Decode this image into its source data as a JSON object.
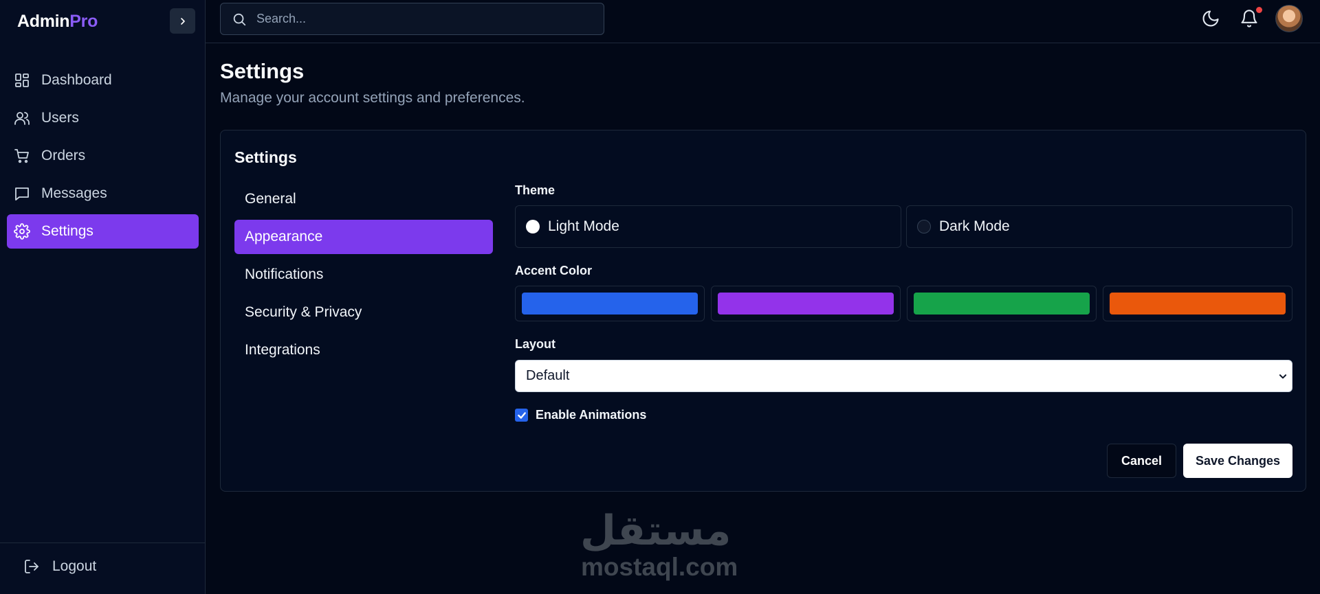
{
  "brand": {
    "part1": "Admin",
    "part2": "Pro"
  },
  "sidebar": {
    "items": [
      {
        "label": "Dashboard",
        "icon": "dashboard-icon"
      },
      {
        "label": "Users",
        "icon": "users-icon"
      },
      {
        "label": "Orders",
        "icon": "cart-icon"
      },
      {
        "label": "Messages",
        "icon": "message-icon"
      },
      {
        "label": "Settings",
        "icon": "gear-icon",
        "active": true
      }
    ],
    "logout": "Logout"
  },
  "search": {
    "placeholder": "Search..."
  },
  "header": {
    "title": "Settings",
    "subtitle": "Manage your account settings and preferences."
  },
  "card": {
    "title": "Settings",
    "tabs": [
      "General",
      "Appearance",
      "Notifications",
      "Security & Privacy",
      "Integrations"
    ],
    "active_tab": "Appearance"
  },
  "appearance": {
    "theme_label": "Theme",
    "theme_options": [
      "Light Mode",
      "Dark Mode"
    ],
    "theme_selected": "Light Mode",
    "accent_label": "Accent Color",
    "accent_colors": [
      "#2563eb",
      "#9333ea",
      "#16a34a",
      "#ea580c"
    ],
    "layout_label": "Layout",
    "layout_value": "Default",
    "animations_label": "Enable Animations",
    "animations_enabled": true
  },
  "buttons": {
    "cancel": "Cancel",
    "save": "Save Changes"
  },
  "watermark": {
    "arabic": "مستقل",
    "latin": "mostaql.com"
  },
  "colors": {
    "accent": "#7c3aed",
    "background": "#020817",
    "sidebar": "#050d22"
  }
}
